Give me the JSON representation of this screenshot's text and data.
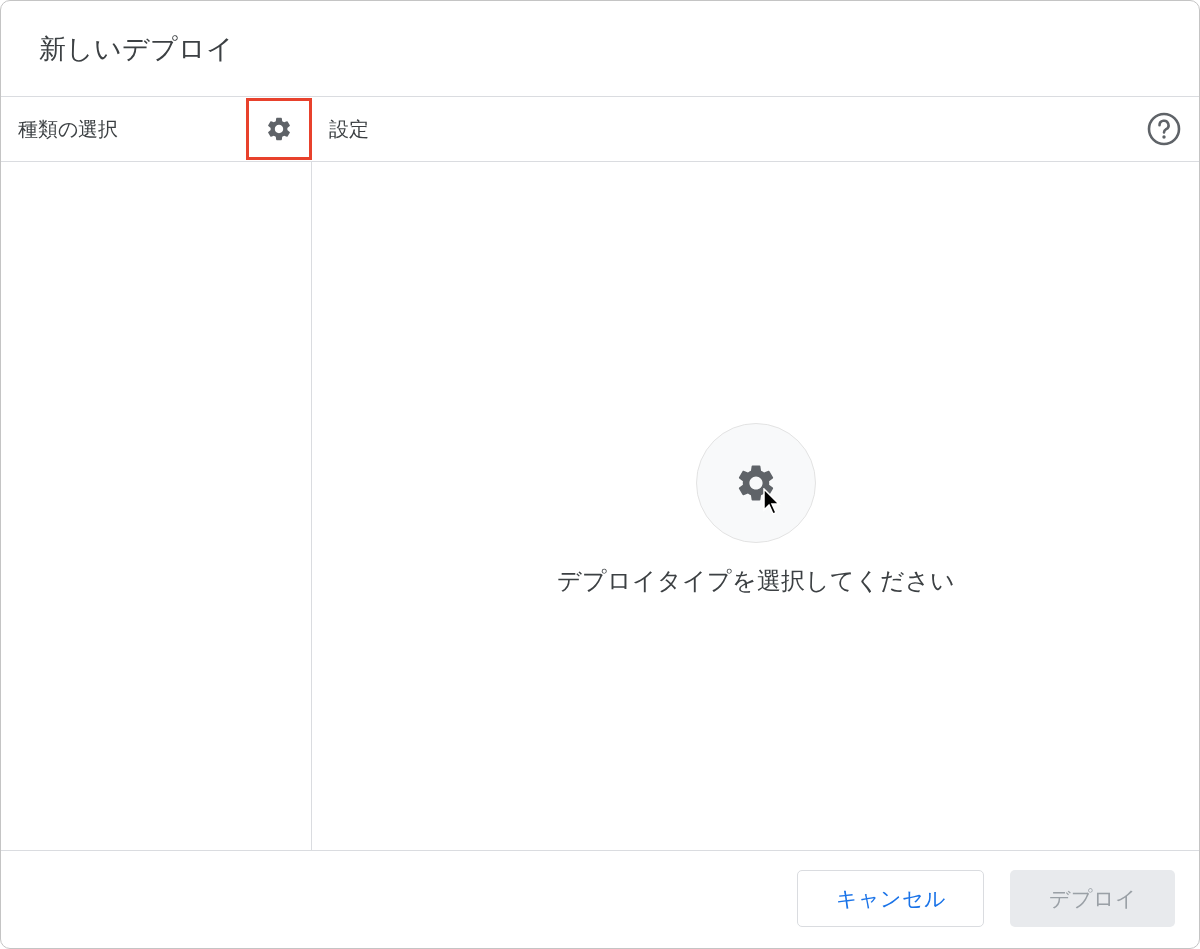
{
  "dialog": {
    "title": "新しいデプロイ"
  },
  "sidebar": {
    "title": "種類の選択",
    "settings_button": {
      "highlighted": true
    }
  },
  "panel": {
    "title": "設定",
    "empty_state": {
      "message": "デプロイタイプを選択してください",
      "cursor_visible": true
    }
  },
  "buttons": [
    {
      "label": "キャンセル",
      "kind": "secondary",
      "disabled": false
    },
    {
      "label": "デプロイ",
      "kind": "primary",
      "disabled": true
    }
  ]
}
